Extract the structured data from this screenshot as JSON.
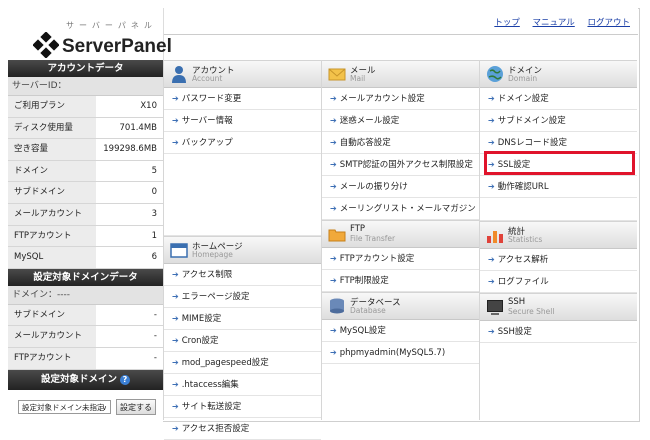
{
  "header": {
    "logo_kana": "サーバーパネル",
    "logo_text": "ServerPanel",
    "links": [
      "トップ",
      "マニュアル",
      "ログアウト"
    ]
  },
  "sidebar": {
    "account_title": "アカウントデータ",
    "server_id_label": "サーバーID：",
    "rows": [
      {
        "key": "ご利用プラン",
        "value": "X10"
      },
      {
        "key": "ディスク使用量",
        "value": "701.4MB"
      },
      {
        "key": "空き容量",
        "value": "199298.6MB"
      },
      {
        "key": "ドメイン",
        "value": "5"
      },
      {
        "key": "サブドメイン",
        "value": "0"
      },
      {
        "key": "メールアカウント",
        "value": "3"
      },
      {
        "key": "FTPアカウント",
        "value": "1"
      },
      {
        "key": "MySQL",
        "value": "6"
      }
    ],
    "domain_data_title": "設定対象ドメインデータ",
    "domain_label": "ドメイン：----",
    "domain_rows": [
      {
        "key": "サブドメイン",
        "value": "-"
      },
      {
        "key": "メールアカウント",
        "value": "-"
      },
      {
        "key": "FTPアカウント",
        "value": "-"
      }
    ],
    "target_domain_title": "設定対象ドメイン",
    "help_mark": "?",
    "select_value": "設定対象ドメイン未指定",
    "set_button": "設定する"
  },
  "columns": {
    "account": {
      "title": "アカウント",
      "sub": "Account",
      "items": [
        "パスワード変更",
        "サーバー情報",
        "バックアップ"
      ]
    },
    "mail": {
      "title": "メール",
      "sub": "Mail",
      "items": [
        "メールアカウント設定",
        "迷惑メール設定",
        "自動応答設定",
        "SMTP認証の国外アクセス制限設定",
        "メールの振り分け",
        "メーリングリスト・メールマガジン"
      ]
    },
    "domain": {
      "title": "ドメイン",
      "sub": "Domain",
      "items": [
        "ドメイン設定",
        "サブドメイン設定",
        "DNSレコード設定",
        "SSL設定",
        "動作確認URL"
      ]
    },
    "homepage": {
      "title": "ホームページ",
      "sub": "Homepage",
      "items": [
        "アクセス制限",
        "エラーページ設定",
        "MIME設定",
        "Cron設定",
        "mod_pagespeed設定",
        ".htaccess編集",
        "サイト転送設定",
        "アクセス拒否設定"
      ]
    },
    "ftp": {
      "title": "FTP",
      "sub": "File Transfer",
      "items": [
        "FTPアカウント設定",
        "FTP制限設定"
      ]
    },
    "database": {
      "title": "データベース",
      "sub": "Database",
      "items": [
        "MySQL設定",
        "phpmyadmin(MySQL5.7)"
      ]
    },
    "stats": {
      "title": "統計",
      "sub": "Statistics",
      "items": [
        "アクセス解析",
        "ログファイル"
      ]
    },
    "ssh": {
      "title": "SSH",
      "sub": "Secure Shell",
      "items": [
        "SSH設定"
      ]
    }
  }
}
